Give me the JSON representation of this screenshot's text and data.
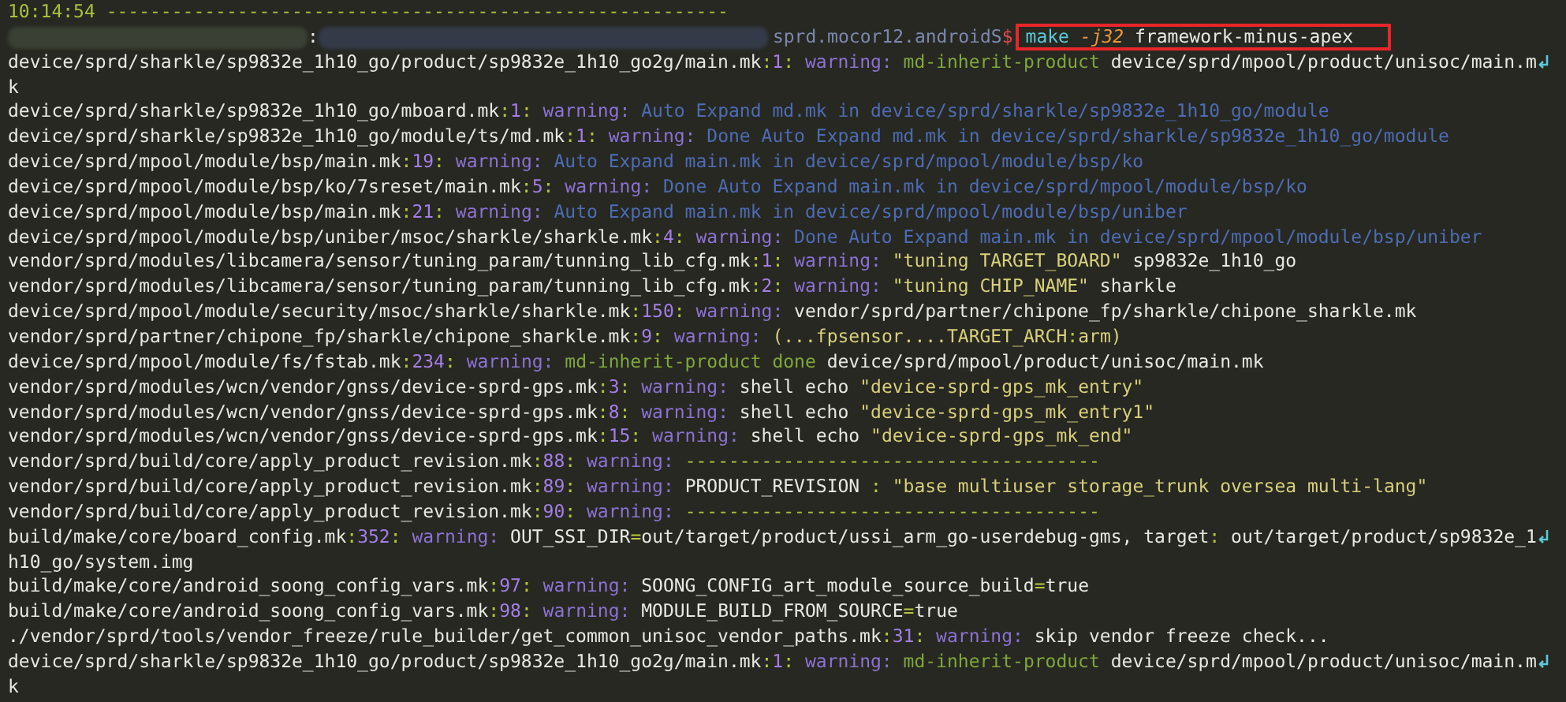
{
  "terminal": {
    "lines": [
      {
        "kind": "log",
        "wrapped": false,
        "segments": [
          {
            "kind": "time",
            "text": "10:14:54"
          },
          {
            "kind": "rule",
            "text": " ---------------------------------------------------------"
          }
        ]
      },
      {
        "kind": "prompt",
        "separator": ":",
        "prompt": [
          {
            "kind": "prompt",
            "text": "sprd.mocor12.androidS"
          },
          {
            "kind": "dollar",
            "text": "$"
          }
        ],
        "command": [
          {
            "kind": "cmd",
            "text": "make"
          },
          {
            "kind": "flag",
            "text": " -j32"
          },
          {
            "kind": "plain",
            "text": " framework-minus-apex"
          }
        ]
      },
      {
        "kind": "log",
        "wrapped": true,
        "segments": [
          {
            "kind": "plain",
            "text": "device/sprd/sharkle/sp9832e_1h10_go/product/sp9832e_1h10_go2g/main.mk"
          },
          {
            "kind": "punct",
            "text": ":"
          },
          {
            "kind": "num",
            "text": "1"
          },
          {
            "kind": "punct",
            "text": ":"
          },
          {
            "kind": "warn",
            "text": " warning:"
          },
          {
            "kind": "inherit",
            "text": " md-inherit-product"
          },
          {
            "kind": "plain",
            "text": " device/sprd/mpool/product/unisoc/main.m"
          }
        ]
      },
      {
        "kind": "log",
        "wrapped": false,
        "segments": [
          {
            "kind": "plain",
            "text": "k"
          }
        ]
      },
      {
        "kind": "log",
        "wrapped": false,
        "segments": [
          {
            "kind": "plain",
            "text": "device/sprd/sharkle/sp9832e_1h10_go/mboard.mk"
          },
          {
            "kind": "punct",
            "text": ":"
          },
          {
            "kind": "num",
            "text": "1"
          },
          {
            "kind": "punct",
            "text": ":"
          },
          {
            "kind": "warn",
            "text": " warning:"
          },
          {
            "kind": "info",
            "text": " Auto Expand md.mk in device/sprd/sharkle/sp9832e_1h10_go/module"
          }
        ]
      },
      {
        "kind": "log",
        "wrapped": false,
        "segments": [
          {
            "kind": "plain",
            "text": "device/sprd/sharkle/sp9832e_1h10_go/module/ts/md.mk"
          },
          {
            "kind": "punct",
            "text": ":"
          },
          {
            "kind": "num",
            "text": "1"
          },
          {
            "kind": "punct",
            "text": ":"
          },
          {
            "kind": "warn",
            "text": " warning:"
          },
          {
            "kind": "info",
            "text": " Done Auto Expand md.mk in device/sprd/sharkle/sp9832e_1h10_go/module"
          }
        ]
      },
      {
        "kind": "log",
        "wrapped": false,
        "segments": [
          {
            "kind": "plain",
            "text": "device/sprd/mpool/module/bsp/main.mk"
          },
          {
            "kind": "punct",
            "text": ":"
          },
          {
            "kind": "num",
            "text": "19"
          },
          {
            "kind": "punct",
            "text": ":"
          },
          {
            "kind": "warn",
            "text": " warning:"
          },
          {
            "kind": "info",
            "text": " Auto Expand main.mk in device/sprd/mpool/module/bsp/ko"
          }
        ]
      },
      {
        "kind": "log",
        "wrapped": false,
        "segments": [
          {
            "kind": "plain",
            "text": "device/sprd/mpool/module/bsp/ko/7sreset/main.mk"
          },
          {
            "kind": "punct",
            "text": ":"
          },
          {
            "kind": "num",
            "text": "5"
          },
          {
            "kind": "punct",
            "text": ":"
          },
          {
            "kind": "warn",
            "text": " warning:"
          },
          {
            "kind": "info",
            "text": " Done Auto Expand main.mk in device/sprd/mpool/module/bsp/ko"
          }
        ]
      },
      {
        "kind": "log",
        "wrapped": false,
        "segments": [
          {
            "kind": "plain",
            "text": "device/sprd/mpool/module/bsp/main.mk"
          },
          {
            "kind": "punct",
            "text": ":"
          },
          {
            "kind": "num",
            "text": "21"
          },
          {
            "kind": "punct",
            "text": ":"
          },
          {
            "kind": "warn",
            "text": " warning:"
          },
          {
            "kind": "info",
            "text": " Auto Expand main.mk in device/sprd/mpool/module/bsp/uniber"
          }
        ]
      },
      {
        "kind": "log",
        "wrapped": false,
        "segments": [
          {
            "kind": "plain",
            "text": "device/sprd/mpool/module/bsp/uniber/msoc/sharkle/sharkle.mk"
          },
          {
            "kind": "punct",
            "text": ":"
          },
          {
            "kind": "num",
            "text": "4"
          },
          {
            "kind": "punct",
            "text": ":"
          },
          {
            "kind": "warn",
            "text": " warning:"
          },
          {
            "kind": "info",
            "text": " Done Auto Expand main.mk in device/sprd/mpool/module/bsp/uniber"
          }
        ]
      },
      {
        "kind": "log",
        "wrapped": false,
        "segments": [
          {
            "kind": "plain",
            "text": "vendor/sprd/modules/libcamera/sensor/tuning_param/tunning_lib_cfg.mk"
          },
          {
            "kind": "punct",
            "text": ":"
          },
          {
            "kind": "num",
            "text": "1"
          },
          {
            "kind": "punct",
            "text": ":"
          },
          {
            "kind": "warn",
            "text": " warning:"
          },
          {
            "kind": "string",
            "text": " \"tuning TARGET_BOARD\""
          },
          {
            "kind": "plain",
            "text": " sp9832e_1h10_go"
          }
        ]
      },
      {
        "kind": "log",
        "wrapped": false,
        "segments": [
          {
            "kind": "plain",
            "text": "vendor/sprd/modules/libcamera/sensor/tuning_param/tunning_lib_cfg.mk"
          },
          {
            "kind": "punct",
            "text": ":"
          },
          {
            "kind": "num",
            "text": "2"
          },
          {
            "kind": "punct",
            "text": ":"
          },
          {
            "kind": "warn",
            "text": " warning:"
          },
          {
            "kind": "string",
            "text": " \"tuning CHIP_NAME\""
          },
          {
            "kind": "plain",
            "text": " sharkle"
          }
        ]
      },
      {
        "kind": "log",
        "wrapped": false,
        "segments": [
          {
            "kind": "plain",
            "text": "device/sprd/mpool/module/security/msoc/sharkle/sharkle.mk"
          },
          {
            "kind": "punct",
            "text": ":"
          },
          {
            "kind": "num",
            "text": "150"
          },
          {
            "kind": "punct",
            "text": ":"
          },
          {
            "kind": "warn",
            "text": " warning:"
          },
          {
            "kind": "plain",
            "text": " vendor/sprd/partner/chipone_fp/sharkle/chipone_sharkle.mk"
          }
        ]
      },
      {
        "kind": "log",
        "wrapped": false,
        "segments": [
          {
            "kind": "plain",
            "text": "vendor/sprd/partner/chipone_fp/sharkle/chipone_sharkle.mk"
          },
          {
            "kind": "punct",
            "text": ":"
          },
          {
            "kind": "num",
            "text": "9"
          },
          {
            "kind": "punct",
            "text": ":"
          },
          {
            "kind": "warn",
            "text": " warning:"
          },
          {
            "kind": "string",
            "text": " (...fpsensor....TARGET_ARCH"
          },
          {
            "kind": "punct",
            "text": ":"
          },
          {
            "kind": "string",
            "text": "arm)"
          }
        ]
      },
      {
        "kind": "log",
        "wrapped": false,
        "segments": [
          {
            "kind": "plain",
            "text": "device/sprd/mpool/module/fs/fstab.mk"
          },
          {
            "kind": "punct",
            "text": ":"
          },
          {
            "kind": "num",
            "text": "234"
          },
          {
            "kind": "punct",
            "text": ":"
          },
          {
            "kind": "warn",
            "text": " warning:"
          },
          {
            "kind": "inherit",
            "text": " md-inherit-product done"
          },
          {
            "kind": "plain",
            "text": " device/sprd/mpool/product/unisoc/main.mk"
          }
        ]
      },
      {
        "kind": "log",
        "wrapped": false,
        "segments": [
          {
            "kind": "plain",
            "text": "vendor/sprd/modules/wcn/vendor/gnss/device-sprd-gps.mk"
          },
          {
            "kind": "punct",
            "text": ":"
          },
          {
            "kind": "num",
            "text": "3"
          },
          {
            "kind": "punct",
            "text": ":"
          },
          {
            "kind": "warn",
            "text": " warning:"
          },
          {
            "kind": "plain",
            "text": " shell echo "
          },
          {
            "kind": "string",
            "text": "\"device-sprd-gps_mk_entry\""
          }
        ]
      },
      {
        "kind": "log",
        "wrapped": false,
        "segments": [
          {
            "kind": "plain",
            "text": "vendor/sprd/modules/wcn/vendor/gnss/device-sprd-gps.mk"
          },
          {
            "kind": "punct",
            "text": ":"
          },
          {
            "kind": "num",
            "text": "8"
          },
          {
            "kind": "punct",
            "text": ":"
          },
          {
            "kind": "warn",
            "text": " warning:"
          },
          {
            "kind": "plain",
            "text": " shell echo "
          },
          {
            "kind": "string",
            "text": "\"device-sprd-gps_mk_entry1\""
          }
        ]
      },
      {
        "kind": "log",
        "wrapped": false,
        "segments": [
          {
            "kind": "plain",
            "text": "vendor/sprd/modules/wcn/vendor/gnss/device-sprd-gps.mk"
          },
          {
            "kind": "punct",
            "text": ":"
          },
          {
            "kind": "num",
            "text": "15"
          },
          {
            "kind": "punct",
            "text": ":"
          },
          {
            "kind": "warn",
            "text": " warning:"
          },
          {
            "kind": "plain",
            "text": " shell echo "
          },
          {
            "kind": "string",
            "text": "\"device-sprd-gps_mk_end\""
          }
        ]
      },
      {
        "kind": "log",
        "wrapped": false,
        "segments": [
          {
            "kind": "plain",
            "text": "vendor/sprd/build/core/apply_product_revision.mk"
          },
          {
            "kind": "punct",
            "text": ":"
          },
          {
            "kind": "num",
            "text": "88"
          },
          {
            "kind": "punct",
            "text": ":"
          },
          {
            "kind": "warn",
            "text": " warning:"
          },
          {
            "kind": "rule",
            "text": " --------------------------------------"
          }
        ]
      },
      {
        "kind": "log",
        "wrapped": false,
        "segments": [
          {
            "kind": "plain",
            "text": "vendor/sprd/build/core/apply_product_revision.mk"
          },
          {
            "kind": "punct",
            "text": ":"
          },
          {
            "kind": "num",
            "text": "89"
          },
          {
            "kind": "punct",
            "text": ":"
          },
          {
            "kind": "warn",
            "text": " warning:"
          },
          {
            "kind": "plain",
            "text": " PRODUCT_REVISION "
          },
          {
            "kind": "punct",
            "text": ":"
          },
          {
            "kind": "string",
            "text": " \"base multiuser storage_trunk oversea multi-lang\""
          }
        ]
      },
      {
        "kind": "log",
        "wrapped": false,
        "segments": [
          {
            "kind": "plain",
            "text": "vendor/sprd/build/core/apply_product_revision.mk"
          },
          {
            "kind": "punct",
            "text": ":"
          },
          {
            "kind": "num",
            "text": "90"
          },
          {
            "kind": "punct",
            "text": ":"
          },
          {
            "kind": "warn",
            "text": " warning:"
          },
          {
            "kind": "rule",
            "text": " --------------------------------------"
          }
        ]
      },
      {
        "kind": "log",
        "wrapped": true,
        "segments": [
          {
            "kind": "plain",
            "text": "build/make/core/board_config.mk"
          },
          {
            "kind": "punct",
            "text": ":"
          },
          {
            "kind": "num",
            "text": "352"
          },
          {
            "kind": "punct",
            "text": ":"
          },
          {
            "kind": "warn",
            "text": " warning:"
          },
          {
            "kind": "plain",
            "text": " OUT_SSI_DIR"
          },
          {
            "kind": "punct",
            "text": "="
          },
          {
            "kind": "plain",
            "text": "out/target/product/ussi_arm_go-userdebug-gms, target"
          },
          {
            "kind": "punct",
            "text": ":"
          },
          {
            "kind": "plain",
            "text": " out/target/product/sp9832e_1"
          }
        ]
      },
      {
        "kind": "log",
        "wrapped": false,
        "segments": [
          {
            "kind": "plain",
            "text": "h10_go/system.img"
          }
        ]
      },
      {
        "kind": "log",
        "wrapped": false,
        "segments": [
          {
            "kind": "plain",
            "text": "build/make/core/android_soong_config_vars.mk"
          },
          {
            "kind": "punct",
            "text": ":"
          },
          {
            "kind": "num",
            "text": "97"
          },
          {
            "kind": "punct",
            "text": ":"
          },
          {
            "kind": "warn",
            "text": " warning:"
          },
          {
            "kind": "plain",
            "text": " SOONG_CONFIG_art_module_source_build"
          },
          {
            "kind": "punct",
            "text": "="
          },
          {
            "kind": "plain",
            "text": "true"
          }
        ]
      },
      {
        "kind": "log",
        "wrapped": false,
        "segments": [
          {
            "kind": "plain",
            "text": "build/make/core/android_soong_config_vars.mk"
          },
          {
            "kind": "punct",
            "text": ":"
          },
          {
            "kind": "num",
            "text": "98"
          },
          {
            "kind": "punct",
            "text": ":"
          },
          {
            "kind": "warn",
            "text": " warning:"
          },
          {
            "kind": "plain",
            "text": " MODULE_BUILD_FROM_SOURCE"
          },
          {
            "kind": "punct",
            "text": "="
          },
          {
            "kind": "plain",
            "text": "true"
          }
        ]
      },
      {
        "kind": "log",
        "wrapped": false,
        "segments": [
          {
            "kind": "plain",
            "text": "./vendor/sprd/tools/vendor_freeze/rule_builder/get_common_unisoc_vendor_paths.mk"
          },
          {
            "kind": "punct",
            "text": ":"
          },
          {
            "kind": "num",
            "text": "31"
          },
          {
            "kind": "punct",
            "text": ":"
          },
          {
            "kind": "warn",
            "text": " warning:"
          },
          {
            "kind": "plain",
            "text": " skip vendor freeze check..."
          }
        ]
      },
      {
        "kind": "log",
        "wrapped": true,
        "segments": [
          {
            "kind": "plain",
            "text": "device/sprd/sharkle/sp9832e_1h10_go/product/sp9832e_1h10_go2g/main.mk"
          },
          {
            "kind": "punct",
            "text": ":"
          },
          {
            "kind": "num",
            "text": "1"
          },
          {
            "kind": "punct",
            "text": ":"
          },
          {
            "kind": "warn",
            "text": " warning:"
          },
          {
            "kind": "inherit",
            "text": " md-inherit-product"
          },
          {
            "kind": "plain",
            "text": " device/sprd/mpool/product/unisoc/main.m"
          }
        ]
      },
      {
        "kind": "log",
        "wrapped": false,
        "segments": [
          {
            "kind": "plain",
            "text": "k"
          }
        ]
      }
    ]
  }
}
